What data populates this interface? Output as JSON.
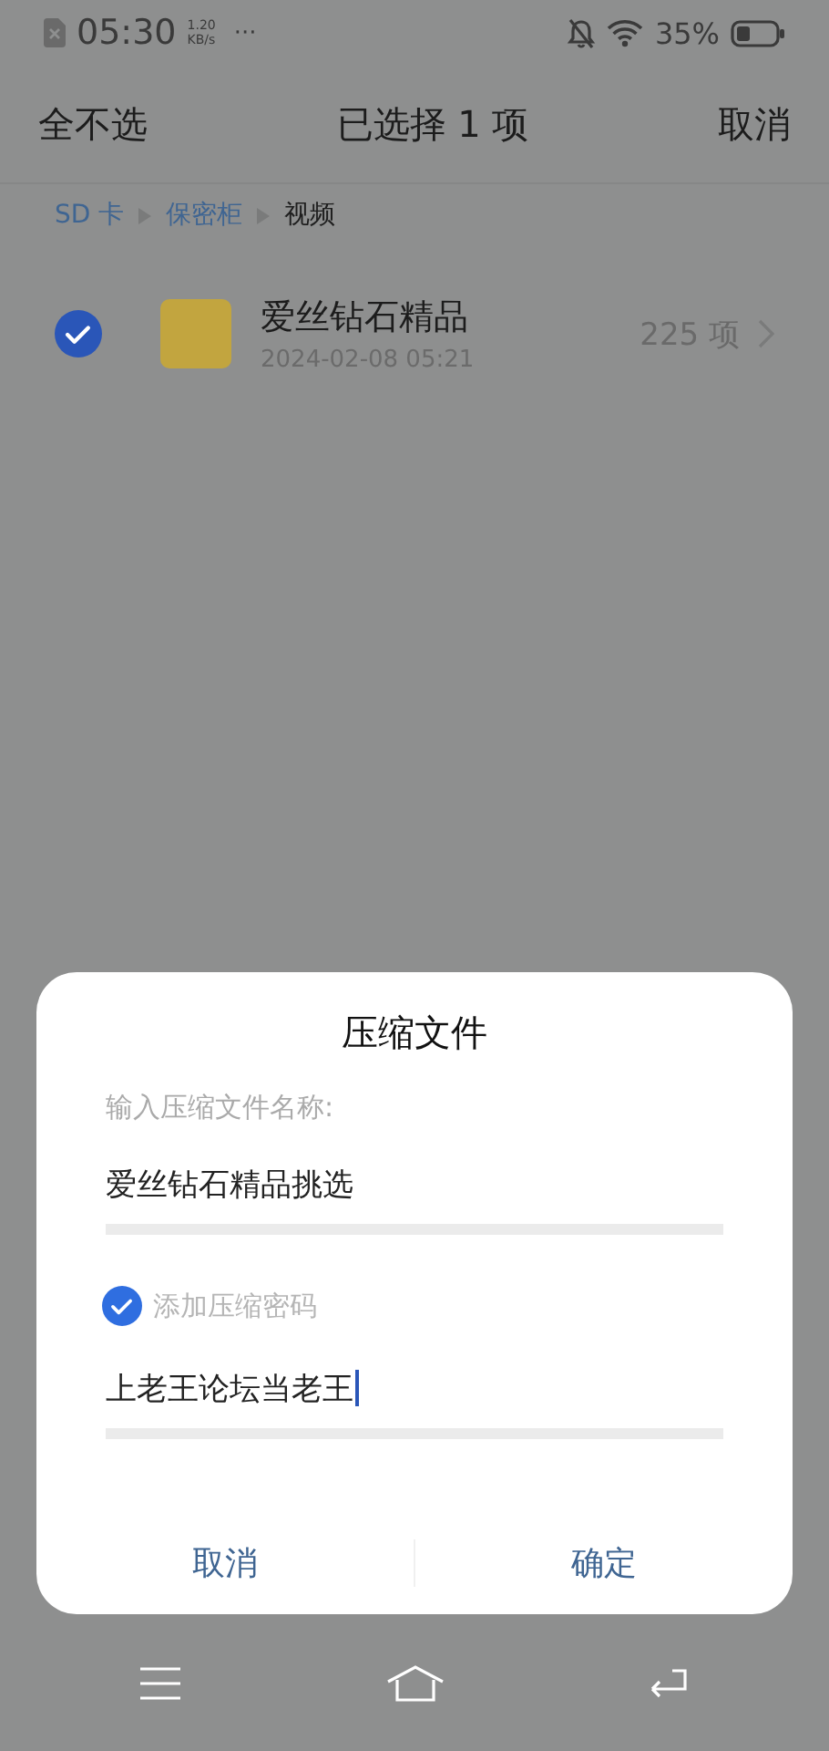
{
  "status_bar": {
    "time": "05:30",
    "speed": "1.20",
    "speed_unit": "KB/s",
    "more": "···",
    "battery": "35%"
  },
  "header": {
    "left_action": "全不选",
    "title": "已选择 1 项",
    "right_action": "取消"
  },
  "breadcrumb": [
    {
      "label": "SD 卡",
      "selected": false
    },
    {
      "label": "保密柜",
      "selected": false
    },
    {
      "label": "视频",
      "selected": true
    }
  ],
  "files": [
    {
      "name": "爱丝钻石精品",
      "date": "2024-02-08 05:21",
      "count": "225 项",
      "checked": true
    }
  ],
  "dialog": {
    "title": "压缩文件",
    "name_label": "输入压缩文件名称:",
    "name_value": "爱丝钻石精品挑选",
    "password_option": {
      "label": "添加压缩密码",
      "checked": true
    },
    "password_value": "上老王论坛当老王",
    "password_focused": true,
    "buttons": [
      {
        "label": "取消"
      },
      {
        "label": "确定"
      }
    ]
  }
}
